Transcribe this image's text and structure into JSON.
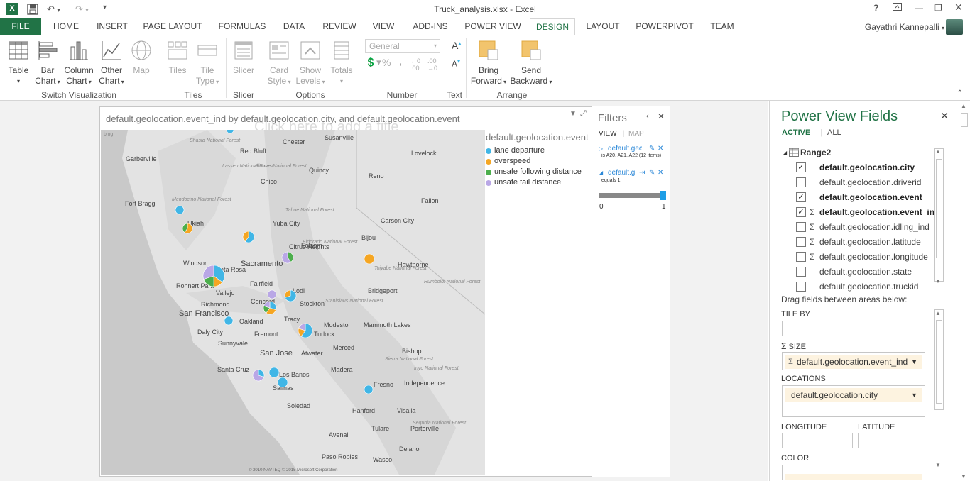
{
  "window": {
    "title": "Truck_analysis.xlsx - Excel",
    "app_icon": "X",
    "help": "?",
    "user_name": "Gayathri Kannepalli"
  },
  "tabs": [
    "FILE",
    "HOME",
    "INSERT",
    "PAGE LAYOUT",
    "FORMULAS",
    "DATA",
    "REVIEW",
    "VIEW",
    "ADD-INS",
    "POWER VIEW",
    "DESIGN",
    "LAYOUT",
    "POWERPIVOT",
    "TEAM"
  ],
  "active_tab": "DESIGN",
  "ribbon": {
    "switch_viz": {
      "label": "Switch Visualization",
      "table": [
        "Table",
        ""
      ],
      "bar": [
        "Bar",
        "Chart"
      ],
      "column": [
        "Column",
        "Chart"
      ],
      "other": [
        "Other",
        "Chart"
      ],
      "map": "Map"
    },
    "tiles": {
      "label": "Tiles",
      "tiles": "Tiles",
      "tile_type": [
        "Tile",
        "Type"
      ]
    },
    "slicer": {
      "label": "Slicer",
      "slicer": "Slicer"
    },
    "options": {
      "label": "Options",
      "card_style": [
        "Card",
        "Style"
      ],
      "show_levels": [
        "Show",
        "Levels"
      ],
      "totals": "Totals"
    },
    "number": {
      "label": "Number",
      "format": "General",
      "percent": "%",
      "comma": ",",
      "inc": "←0 .00",
      "dec": ".00 →0"
    },
    "text": {
      "label": "Text"
    },
    "arrange": {
      "label": "Arrange",
      "bring": [
        "Bring",
        "Forward"
      ],
      "send": [
        "Send",
        "Backward"
      ]
    }
  },
  "viz": {
    "title": "default.geolocation.event_ind by default.geolocation.city, and default.geolocation.event",
    "click_title": "Click here to add a title",
    "map_copyright": "© 2010 NAVTEQ © 2015 Microsoft Corporation",
    "bing": "bing"
  },
  "legend": {
    "title": "default.geolocation.event",
    "items": [
      {
        "label": "lane departure",
        "color": "#41b6e6"
      },
      {
        "label": "overspeed",
        "color": "#f5a623"
      },
      {
        "label": "unsafe following distance",
        "color": "#4cae4c"
      },
      {
        "label": "unsafe tail distance",
        "color": "#b9a7e6"
      }
    ]
  },
  "map_labels": [
    "Susanville",
    "Chester",
    "Red Bluff",
    "Lovelock",
    "Garberville",
    "Quincy",
    "Reno",
    "Chico",
    "Fort Bragg",
    "Fallon",
    "Carson City",
    "Ukiah",
    "Yuba City",
    "Bijou",
    "Citrus Heights",
    "Folsom",
    "Sacramento",
    "Hawthorne",
    "Windsor",
    "Santa Rosa",
    "Rohnert Park",
    "Fairfield",
    "Vallejo",
    "Lodi",
    "Bridgeport",
    "Concord",
    "Richmond",
    "Stockton",
    "San Francisco",
    "Oakland",
    "Tracy",
    "Modesto",
    "Mammoth Lakes",
    "Daly City",
    "Fremont",
    "Turlock",
    "Sunnyvale",
    "San Jose",
    "Merced",
    "Bishop",
    "Atwater",
    "Santa Cruz",
    "Los Banos",
    "Madera",
    "Independence",
    "Salinas",
    "Fresno",
    "Soledad",
    "Hanford",
    "Visalia",
    "Tulare",
    "Porterville",
    "Avenal",
    "Delano",
    "Paso Robles",
    "Wasco",
    "Mendocino National Forest",
    "Tahoe National Forest",
    "Eldorado National Forest",
    "Stanislaus National Forest",
    "Sierra National Forest",
    "Inyo National Forest",
    "Sequoia National Forest",
    "Toiyabe National Forest",
    "Shasta National Forest",
    "Lassen National Forest",
    "Plumas National Forest",
    "Humboldt National Forest"
  ],
  "filters": {
    "title": "Filters",
    "view": "VIEW",
    "map": "MAP",
    "filter1_name": "default.geolo",
    "filter1_desc": "is A20, A21, A22 (12 items)",
    "filter2_name": "default.g",
    "filter2_desc": "equals 1",
    "slider_min": "0",
    "slider_max": "1",
    "slider_value": 1
  },
  "field_list": {
    "title": "Power View Fields",
    "tab_active": "ACTIVE",
    "tab_all": "ALL",
    "table_name": "Range2",
    "fields": [
      {
        "name": "default.geolocation.city",
        "checked": true,
        "sigma": false,
        "bold": true
      },
      {
        "name": "default.geolocation.driverid",
        "checked": false,
        "sigma": false,
        "bold": false
      },
      {
        "name": "default.geolocation.event",
        "checked": true,
        "sigma": false,
        "bold": true
      },
      {
        "name": "default.geolocation.event_ind",
        "checked": true,
        "sigma": true,
        "bold": true
      },
      {
        "name": "default.geolocation.idling_ind",
        "checked": false,
        "sigma": true,
        "bold": false
      },
      {
        "name": "default.geolocation.latitude",
        "checked": false,
        "sigma": true,
        "bold": false
      },
      {
        "name": "default.geolocation.longitude",
        "checked": false,
        "sigma": true,
        "bold": false
      },
      {
        "name": "default.geolocation.state",
        "checked": false,
        "sigma": false,
        "bold": false
      },
      {
        "name": "default.geolocation.truckid",
        "checked": false,
        "sigma": false,
        "bold": false
      }
    ],
    "drag_hint": "Drag fields between areas below:",
    "tile_by": "TILE BY",
    "size": "SIZE",
    "size_value": "default.geolocation.event_ind",
    "locations": "LOCATIONS",
    "locations_value": "default.geolocation.city",
    "longitude": "LONGITUDE",
    "latitude": "LATITUDE",
    "color": "COLOR"
  }
}
